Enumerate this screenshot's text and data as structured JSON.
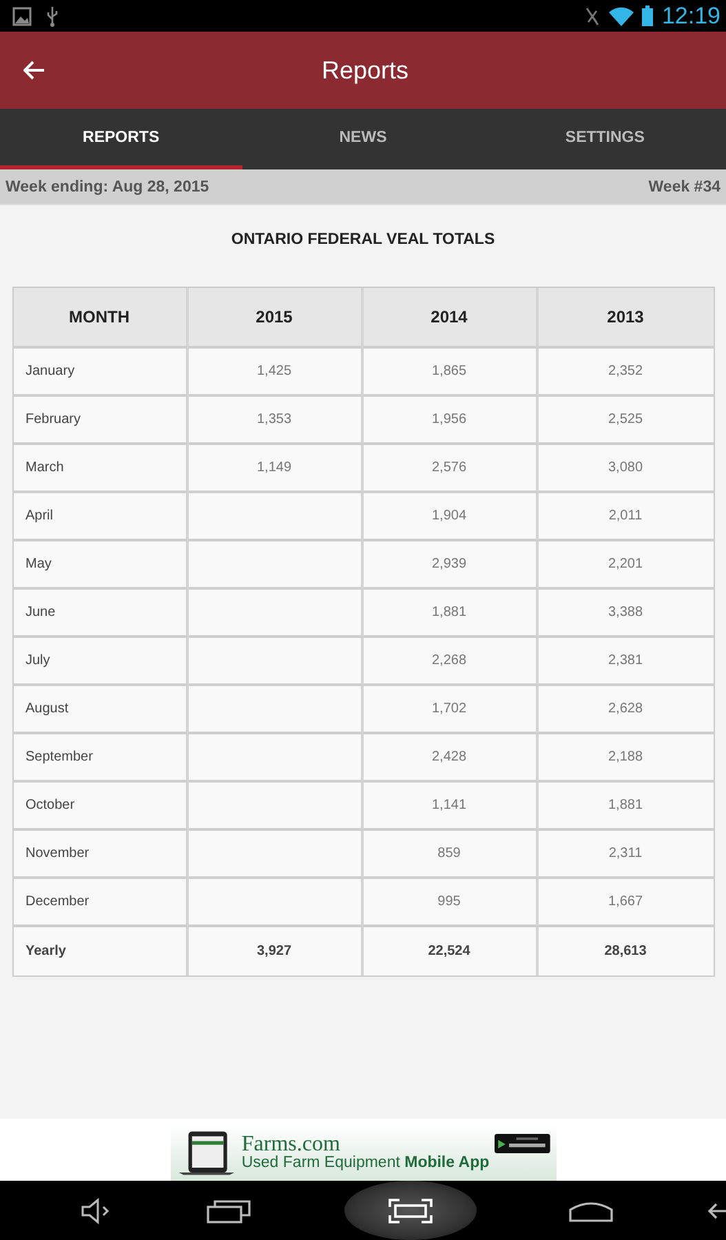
{
  "status_bar": {
    "time": "12:19"
  },
  "app_bar": {
    "title": "Reports"
  },
  "tabs": [
    {
      "label": "REPORTS",
      "selected": true
    },
    {
      "label": "NEWS",
      "selected": false
    },
    {
      "label": "SETTINGS",
      "selected": false
    }
  ],
  "week_bar": {
    "week_ending": "Week ending: Aug 28, 2015",
    "week_number": "Week #34"
  },
  "report": {
    "title": "ONTARIO FEDERAL VEAL TOTALS",
    "columns": [
      "MONTH",
      "2015",
      "2014",
      "2013"
    ],
    "rows": [
      [
        "January",
        "1,425",
        "1,865",
        "2,352"
      ],
      [
        "February",
        "1,353",
        "1,956",
        "2,525"
      ],
      [
        "March",
        "1,149",
        "2,576",
        "3,080"
      ],
      [
        "April",
        "",
        "1,904",
        "2,011"
      ],
      [
        "May",
        "",
        "2,939",
        "2,201"
      ],
      [
        "June",
        "",
        "1,881",
        "3,388"
      ],
      [
        "July",
        "",
        "2,268",
        "2,381"
      ],
      [
        "August",
        "",
        "1,702",
        "2,628"
      ],
      [
        "September",
        "",
        "2,428",
        "2,188"
      ],
      [
        "October",
        "",
        "1,141",
        "1,881"
      ],
      [
        "November",
        "",
        "859",
        "2,311"
      ],
      [
        "December",
        "",
        "995",
        "1,667"
      ]
    ],
    "total_row": [
      "Yearly",
      "3,927",
      "22,524",
      "28,613"
    ]
  },
  "ad": {
    "brand": "Farms.com",
    "tagline": "Used Farm Equipment ",
    "tagline_bold": "Mobile App"
  }
}
